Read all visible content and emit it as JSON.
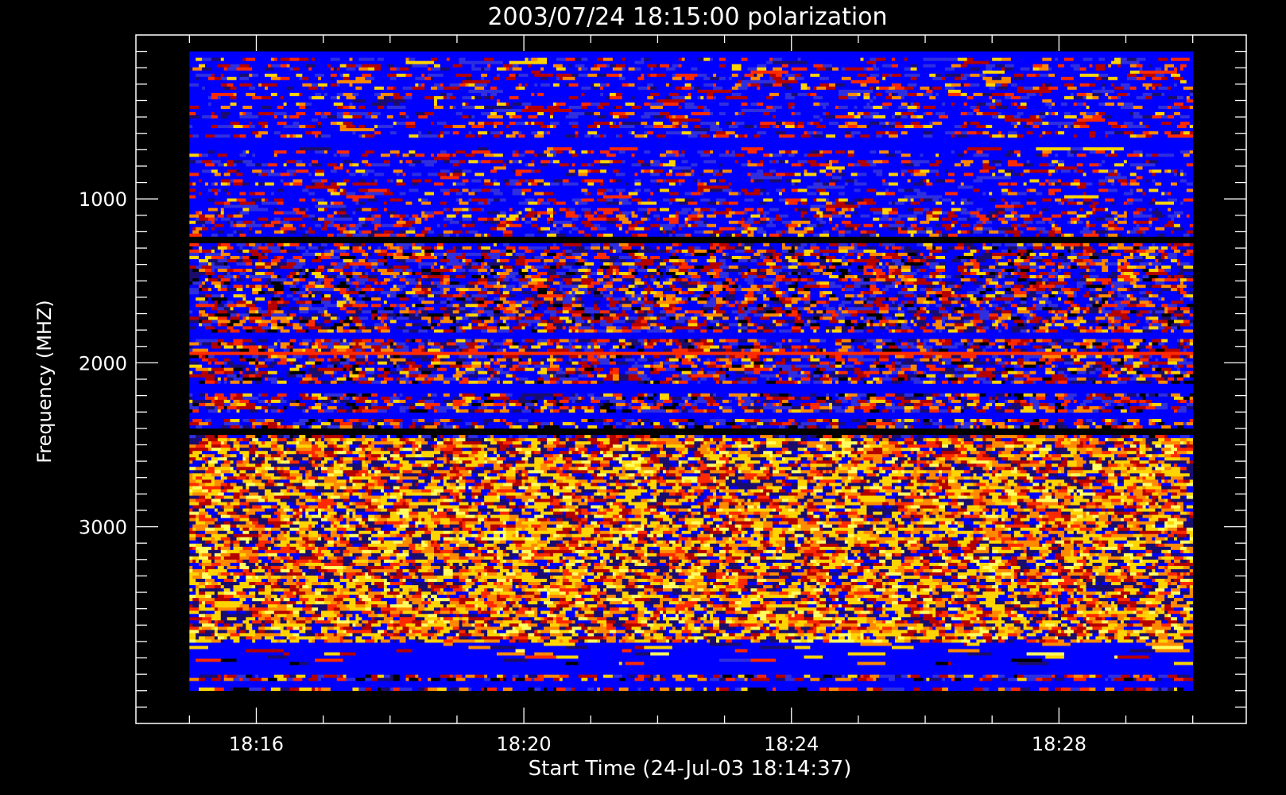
{
  "chart_data": {
    "type": "heatmap",
    "title": "2003/07/24 18:15:00 polarization",
    "xlabel": "Start Time (24-Jul-03 18:14:37)",
    "ylabel": "Frequency (MHZ)",
    "x_ticks": [
      "18:16",
      "18:20",
      "18:24",
      "18:28"
    ],
    "x_tick_values_min": [
      16,
      20,
      24,
      28
    ],
    "x_data_range_min": [
      15,
      30
    ],
    "x_axis_range_min": [
      14.2,
      30.8
    ],
    "y_ticks": [
      "1000",
      "2000",
      "3000"
    ],
    "y_tick_values": [
      1000,
      2000,
      3000
    ],
    "y_data_range": [
      100,
      4000
    ],
    "y_axis_range": [
      0,
      4200
    ],
    "y_inverted": true,
    "colormap": [
      "#000000",
      "#1a0d6e",
      "#0000ff",
      "#2f2fe0",
      "#b40000",
      "#ff2a00",
      "#ff8a00",
      "#ffd400",
      "#ffff60"
    ],
    "frequency_bands": [
      {
        "from": 100,
        "to": 900,
        "pattern": "blue with sparse red/orange speckle"
      },
      {
        "from": 900,
        "to": 1900,
        "pattern": "blue/red mixed noise"
      },
      {
        "from": 1900,
        "to": 2450,
        "pattern": "mixed noise with solid blue and dark bands"
      },
      {
        "from": 2450,
        "to": 3900,
        "pattern": "orange/yellow dense noise"
      },
      {
        "from": 3900,
        "to": 4000,
        "pattern": "solid blue band"
      }
    ]
  }
}
